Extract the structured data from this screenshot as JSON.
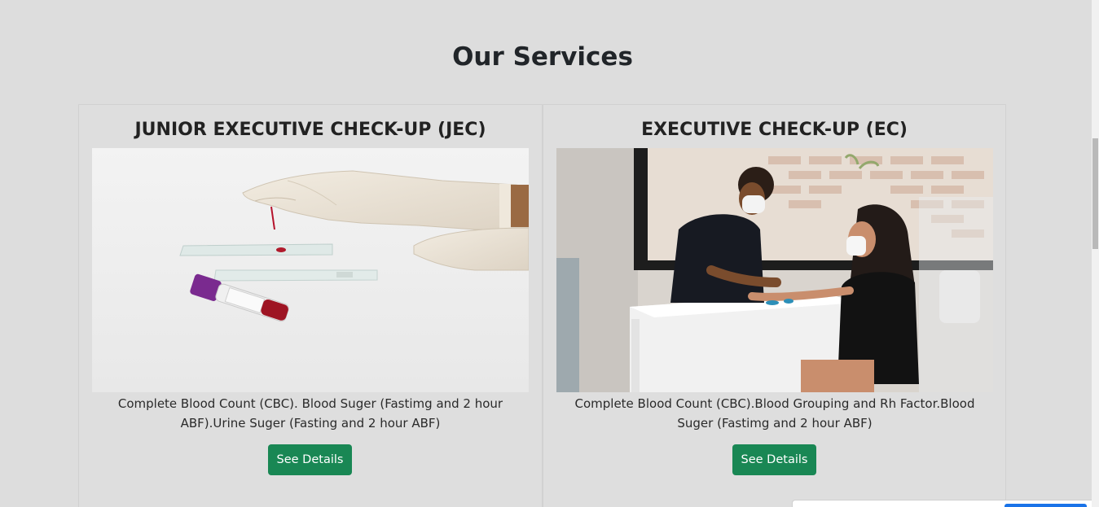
{
  "section": {
    "title": "Our Services"
  },
  "cards": [
    {
      "title": "JUNIOR EXECUTIVE CHECK-UP (JEC)",
      "description": "Complete Blood Count (CBC). Blood Suger (Fastimg and 2 hour ABF).Urine Suger (Fasting and 2 hour ABF)",
      "button_label": "See Details",
      "image_alt": "Gloved hand holding blood sample slide with blood tube"
    },
    {
      "title": "EXECUTIVE CHECK-UP (EC)",
      "description": "Complete Blood Count (CBC).Blood Grouping and Rh Factor.Blood Suger (Fastimg and 2 hour ABF)",
      "button_label": "See Details",
      "image_alt": "Nurse taking blood sample from seated patient"
    }
  ],
  "colors": {
    "button": "#198754",
    "background": "#dddddd"
  }
}
